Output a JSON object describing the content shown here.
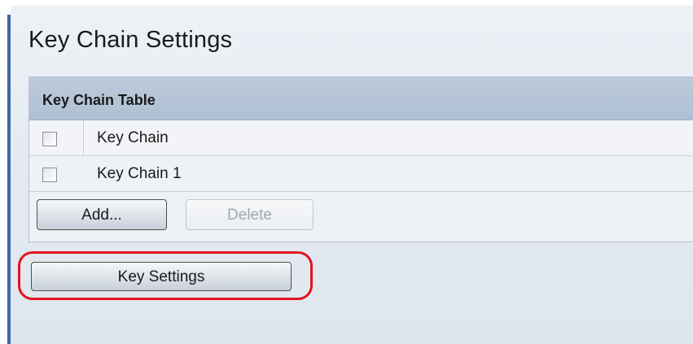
{
  "page": {
    "title": "Key Chain Settings"
  },
  "key_chain_table": {
    "caption": "Key Chain Table",
    "rows": [
      {
        "name": "Key Chain",
        "checked": false
      },
      {
        "name": "Key Chain 1",
        "checked": false
      }
    ],
    "add_label": "Add...",
    "delete_label": "Delete",
    "delete_enabled": false
  },
  "key_settings_button": {
    "label": "Key Settings",
    "highlight_color": "#e2141d"
  },
  "colors": {
    "accent_bar": "#3c6aa8",
    "header_bg": "#b5c5d7"
  }
}
